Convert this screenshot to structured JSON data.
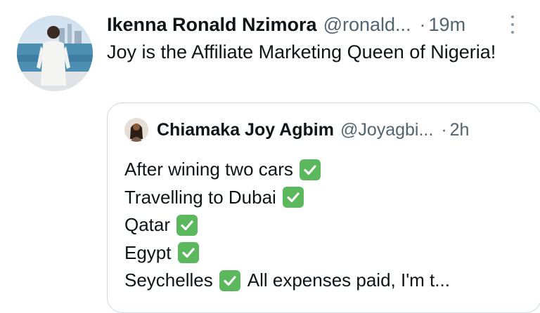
{
  "tweet": {
    "author_name": "Ikenna Ronald Nzimora",
    "author_handle": "@ronald...",
    "separator": "·",
    "time": "19m",
    "text": "Joy is the Affiliate Marketing Queen of Nigeria!",
    "avatar_icon": "user-photo-avatar"
  },
  "quote": {
    "author_name": "Chiamaka Joy Agbim",
    "author_handle": "@Joyagbi...",
    "separator": "·",
    "time": "2h",
    "avatar_icon": "user-photo-avatar",
    "check_emoji_color": "#5cb85c",
    "lines": [
      {
        "text": "After wining two cars",
        "after": ""
      },
      {
        "text": "Travelling to Dubai",
        "after": ""
      },
      {
        "text": "Qatar",
        "after": ""
      },
      {
        "text": "Egypt",
        "after": ""
      },
      {
        "text": "Seychelles",
        "after": "All expenses paid, I'm t..."
      }
    ]
  }
}
